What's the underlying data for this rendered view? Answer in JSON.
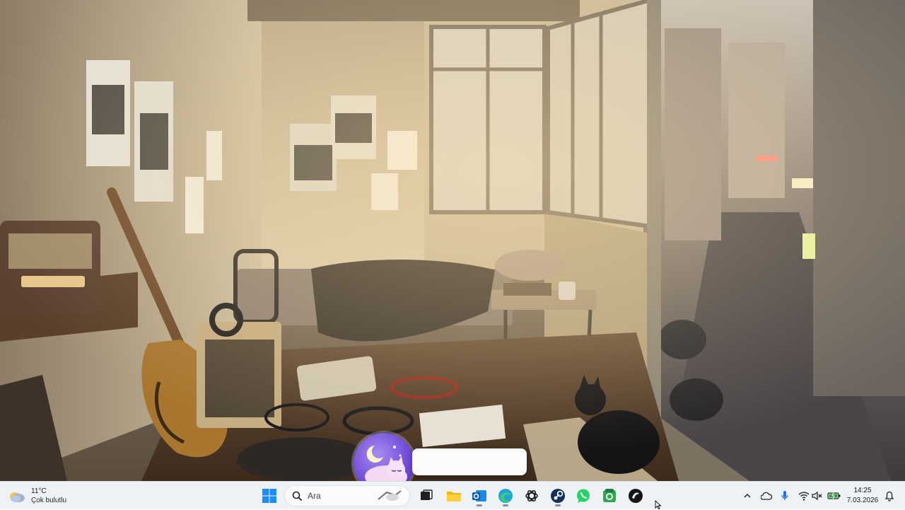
{
  "taskbar": {
    "weather": {
      "temperature": "11°C",
      "condition": "Çok bulutlu",
      "icon": "cloudy-weather-icon"
    },
    "search": {
      "placeholder": "Ara"
    },
    "apps": [
      {
        "name": "start-icon"
      },
      {
        "name": "search-icon"
      },
      {
        "name": "task-view-icon"
      },
      {
        "name": "file-explorer-icon"
      },
      {
        "name": "outlook-icon"
      },
      {
        "name": "edge-icon"
      },
      {
        "name": "chatgpt-icon"
      },
      {
        "name": "steam-icon"
      },
      {
        "name": "whatsapp-icon"
      },
      {
        "name": "xbox-app-icon"
      },
      {
        "name": "media-app-icon"
      }
    ],
    "tray": {
      "time": "14:25",
      "date": "7.03.2026",
      "icons": [
        "chevron-up-icon",
        "onedrive-icon",
        "microphone-icon",
        "wifi-icon",
        "speaker-muted-icon",
        "battery-charging-icon",
        "notification-bell-icon"
      ]
    },
    "accent": "#1a73e8"
  }
}
